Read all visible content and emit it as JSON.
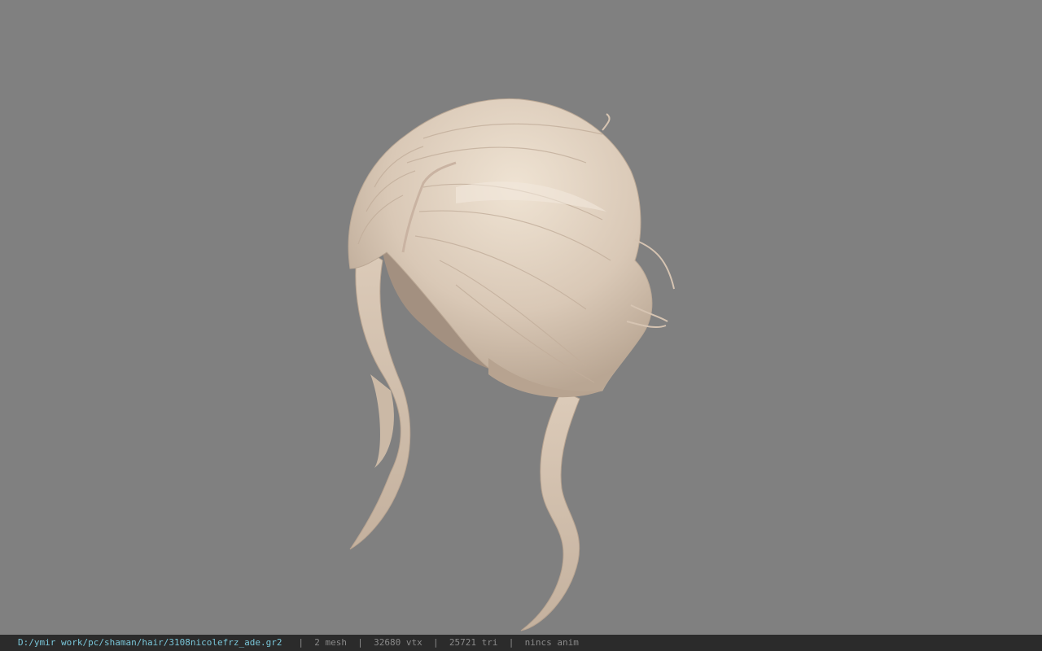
{
  "viewport": {
    "background_color": "#808080",
    "model_color": "#d8c8b8",
    "model_shadow_color": "#a89584",
    "model_highlight_color": "#ecdfcf",
    "model_subject": "hair-model"
  },
  "status_bar": {
    "file_path": "D:/ymir work/pc/shaman/hair/3108nicolefrz_ade.gr2",
    "separator": "|",
    "mesh_count": "2 mesh",
    "vertex_count": "32680 vtx",
    "triangle_count": "25721 tri",
    "anim_status": "nincs anim",
    "path_color": "#79c6d9",
    "text_color": "#8a8a8a",
    "background_color": "#2b2b2b"
  }
}
